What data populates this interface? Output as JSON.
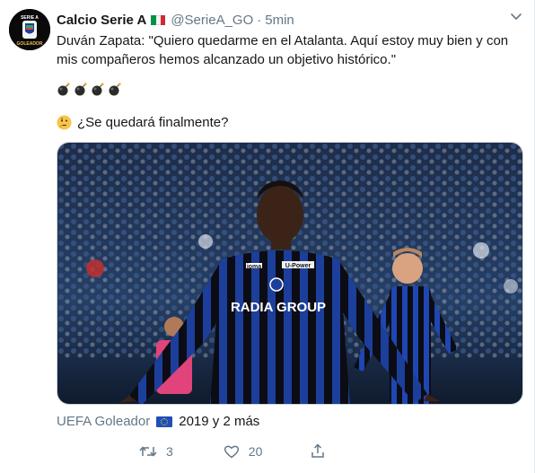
{
  "author": {
    "name": "Calcio Serie A",
    "handle": "@SerieA_GO",
    "separator": "·",
    "time": "5min",
    "avatar_top_text": "SERIE A",
    "avatar_bottom_text": "GOLEADOR"
  },
  "tweet": {
    "line1": "Duván Zapata: \"Quiero quedarme en el Atalanta. Aquí estoy muy bien y con",
    "line2": "mis compañeros hemos alcanzado un objetivo histórico.\"",
    "emoji_bombs": [
      "bomb-icon",
      "bomb-icon",
      "bomb-icon",
      "bomb-icon"
    ],
    "question": "¿Se quedará finalmente?",
    "question_emoji": "thinking-face-icon"
  },
  "photo": {
    "sponsor_text": "RADIA GROUP",
    "kit_brand": "joma",
    "shirt_sponsor": "U-Power"
  },
  "meta": {
    "label": "UEFA Goleador",
    "flag": "eu-flag-icon",
    "year_text": "2019 y 2 más"
  },
  "actions": {
    "retweets": "3",
    "likes": "20"
  },
  "colors": {
    "text": "#14171a",
    "secondary": "#657786",
    "border": "#e6ecf0",
    "atalanta_blue": "#1c3f9c",
    "atalanta_black": "#0c0c14",
    "flag_green": "#009246",
    "flag_white": "#ffffff",
    "flag_red": "#ce2b37"
  }
}
